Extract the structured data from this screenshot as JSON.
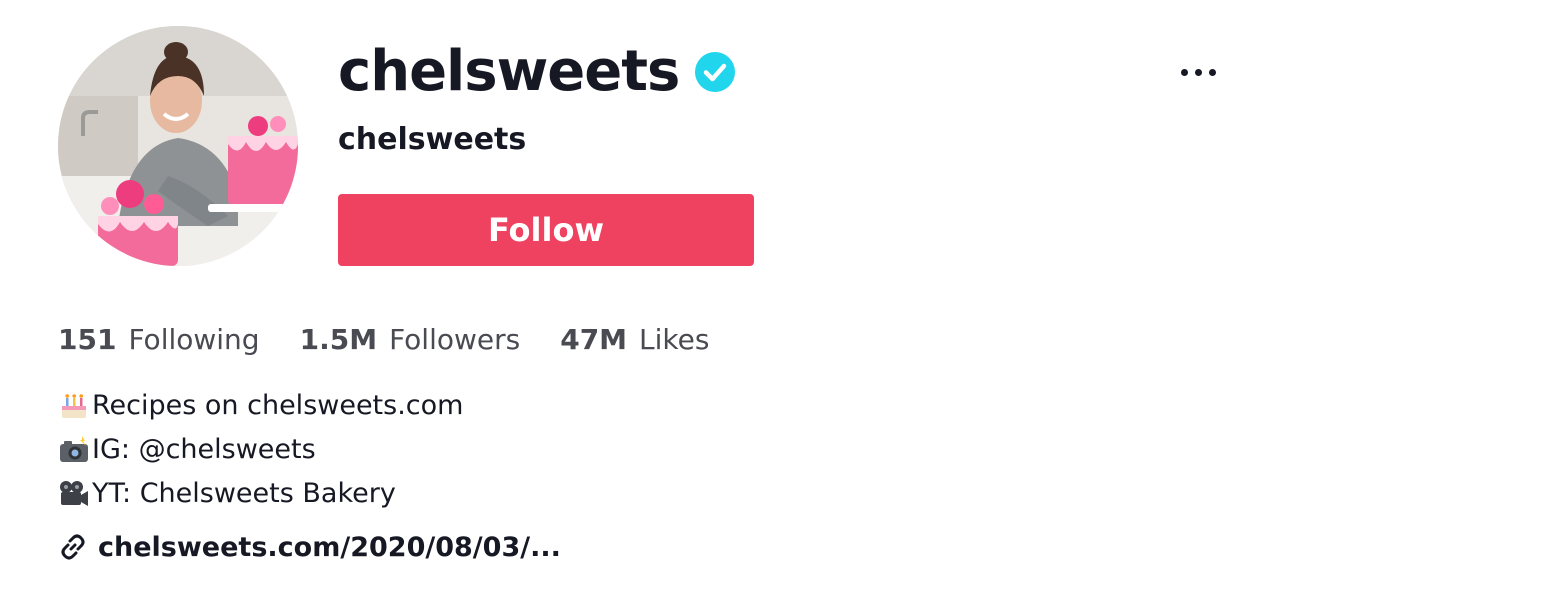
{
  "profile": {
    "title": "chelsweets",
    "subtitle": "chelsweets",
    "verified": true,
    "avatar_alt": "profile-photo"
  },
  "actions": {
    "follow_label": "Follow",
    "more_icon": "more-horizontal-icon"
  },
  "stats": [
    {
      "value": "151",
      "label": "Following"
    },
    {
      "value": "1.5M",
      "label": "Followers"
    },
    {
      "value": "47M",
      "label": "Likes"
    }
  ],
  "bio": [
    {
      "icon": "birthday-cake-icon",
      "text": "Recipes on chelsweets.com"
    },
    {
      "icon": "camera-with-flash-icon",
      "text": "IG: @chelsweets"
    },
    {
      "icon": "movie-camera-icon",
      "text": "YT: Chelsweets Bakery"
    }
  ],
  "link": {
    "icon": "link-icon",
    "text": "chelsweets.com/2020/08/03/..."
  },
  "colors": {
    "follow_button": "#ee4260",
    "verified_badge": "#20d5ec",
    "text_primary": "#161823",
    "text_secondary": "#4a4b52"
  }
}
